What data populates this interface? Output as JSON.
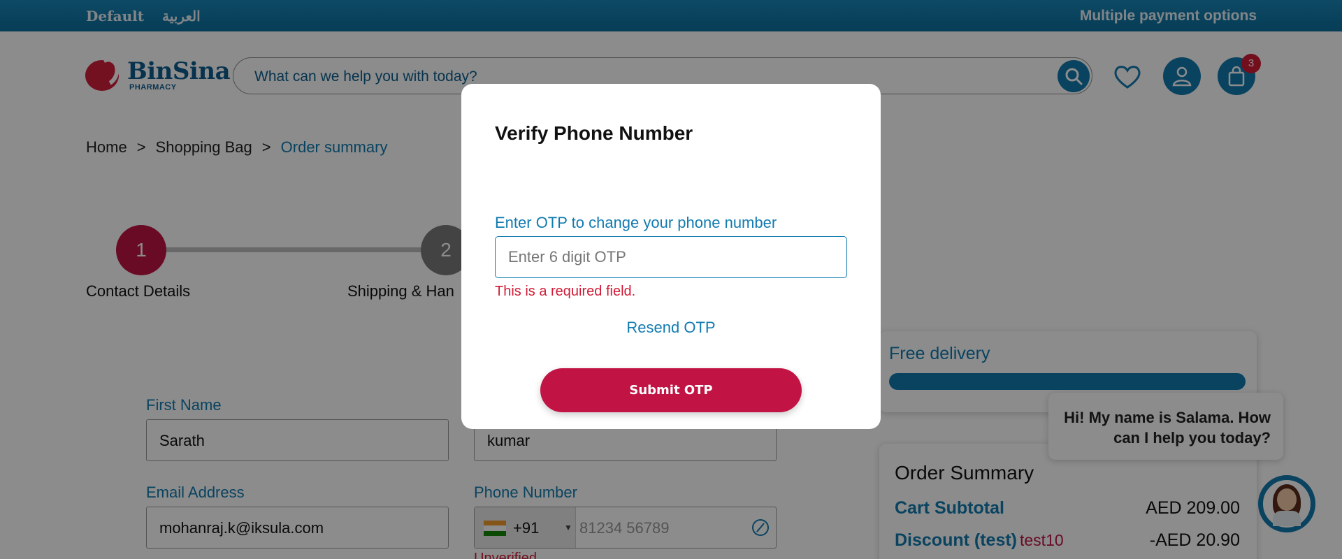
{
  "topbar": {
    "lang_default": "Default",
    "lang_arabic": "العربية",
    "payment": "Multiple payment options"
  },
  "header": {
    "logo_name": "BinSina",
    "logo_sub": "PHARMACY",
    "search_placeholder": "What can we help you with today?",
    "cart_count": "3"
  },
  "breadcrumb": [
    "Home",
    ">",
    "Shopping Bag",
    ">",
    "Order summary"
  ],
  "steps": [
    {
      "number": "1",
      "label": "Contact Details"
    },
    {
      "number": "2",
      "label": "Shipping & Han"
    }
  ],
  "form": {
    "first_name_label": "First Name",
    "first_name_value": "Sarath",
    "last_name_value": "kumar",
    "email_label": "Email Address",
    "email_value": "mohanraj.k@iksula.com",
    "phone_label": "Phone Number",
    "dial_code": "+91",
    "phone_placeholder": "81234 56789",
    "unverified": "Unverified"
  },
  "free_delivery": {
    "title": "Free delivery"
  },
  "order_summary": {
    "title": "Order Summary",
    "subtotal_label": "Cart Subtotal",
    "subtotal_value": "AED 209.00",
    "discount_label": "Discount (test)",
    "discount_code": "test10",
    "discount_value": "-AED 20.90"
  },
  "chat": {
    "message": "Hi! My name is Salama. How can I help you today?"
  },
  "modal": {
    "title": "Verify Phone Number",
    "label": "Enter OTP to change your phone number",
    "otp_placeholder": "Enter 6 digit OTP",
    "error": "This is a required field.",
    "resend": "Resend OTP",
    "submit": "Submit OTP"
  },
  "colors": {
    "primary": "#117bb0",
    "accent": "#c11444",
    "error": "#d11b36"
  }
}
